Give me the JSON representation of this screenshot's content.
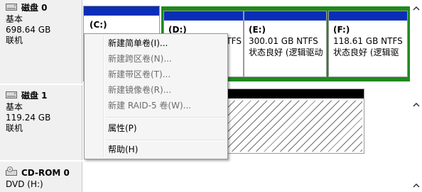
{
  "disk0": {
    "name": "磁盘 0",
    "type": "基本",
    "size": "698.64 GB",
    "status": "联机",
    "partitions": [
      {
        "name": "(C:)"
      },
      {
        "name": "(D:)",
        "fs": "NTFS"
      },
      {
        "name": "(E:)",
        "info": "300.01 GB NTFS",
        "state": "状态良好 (逻辑驱动"
      },
      {
        "name": "(F:)",
        "info": "118.61 GB NTFS",
        "state": "状态良好 (逻辑驱"
      }
    ]
  },
  "disk1": {
    "name": "磁盘 1",
    "type": "基本",
    "size": "119.24 GB",
    "status": "联机"
  },
  "cdrom": {
    "name": "CD-ROM 0",
    "drive": "DVD (H:)"
  },
  "context_menu": {
    "items": [
      {
        "label": "新建简单卷(I)...",
        "enabled": true
      },
      {
        "label": "新建跨区卷(N)...",
        "enabled": false
      },
      {
        "label": "新建带区卷(T)...",
        "enabled": false
      },
      {
        "label": "新建镜像卷(R)...",
        "enabled": false
      },
      {
        "label": "新建 RAID-5 卷(W)...",
        "enabled": false
      },
      {
        "label": "属性(P)",
        "enabled": true
      },
      {
        "label": "帮助(H)",
        "enabled": true
      }
    ]
  },
  "colors": {
    "primary_bar": "#0a2eb8",
    "extended_border": "#1f8a1f",
    "unallocated_bar": "#000000"
  }
}
